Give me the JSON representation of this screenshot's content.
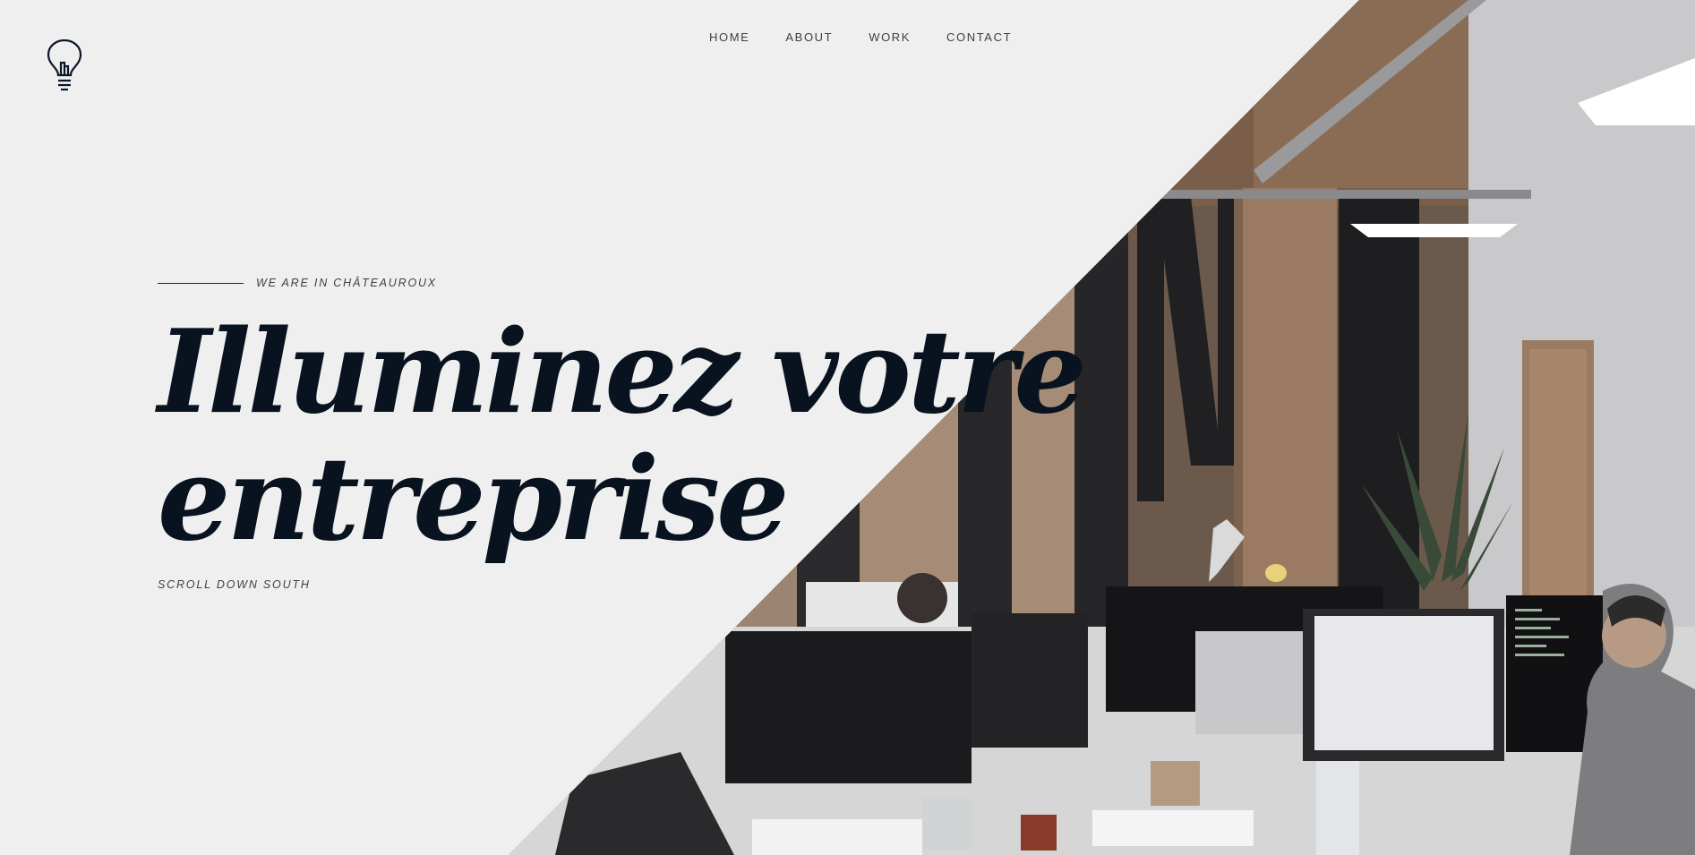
{
  "brand": {
    "logo_icon": "lightbulb-icon"
  },
  "nav": {
    "items": [
      {
        "label": "HOME"
      },
      {
        "label": "ABOUT"
      },
      {
        "label": "WORK"
      },
      {
        "label": "CONTACT"
      }
    ]
  },
  "hero": {
    "tag_icon": "",
    "location": "WE ARE IN CHÂTEAUROUX",
    "title_line1": "Illuminez votre",
    "title_line2": "entreprise",
    "scroll_hint": "SCROLL DOWN SOUTH",
    "image": "office-photo"
  },
  "colors": {
    "background": "#efefef",
    "heading": "#08131f",
    "text": "#3a3f47"
  }
}
